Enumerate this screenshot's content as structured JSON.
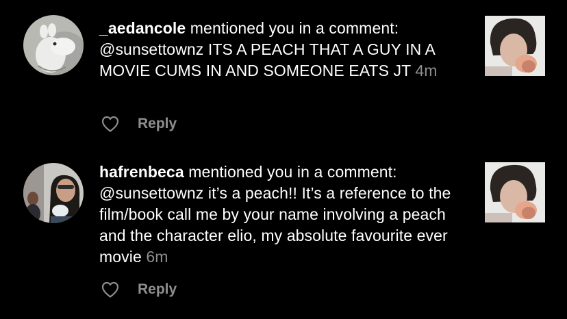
{
  "colors": {
    "background": "#000000",
    "text": "#ffffff",
    "secondary": "#8e8e8e"
  },
  "notifications": [
    {
      "avatar_icon": "moomin-avatar",
      "username": "_aedancole",
      "action": " mentioned you in a comment:",
      "mention": "@sunsettownz",
      "comment": " ITS A PEACH THAT A GUY IN A MOVIE CUMS IN AND SOMEONE EATS JT",
      "time": "4m",
      "thumbnail_icon": "post-photo-thumbnail",
      "like_icon": "heart-outline-icon",
      "reply_label": "Reply"
    },
    {
      "avatar_icon": "user-photo-avatar",
      "username": "hafrenbeca",
      "action": " mentioned you in a comment:",
      "mention": "@sunsettownz",
      "comment": " it’s a peach!! It’s a reference to the film/book call me by your name involving a peach and the character elio, my absolute favourite ever movie",
      "time": "6m",
      "thumbnail_icon": "post-photo-thumbnail",
      "like_icon": "heart-outline-icon",
      "reply_label": "Reply"
    }
  ]
}
